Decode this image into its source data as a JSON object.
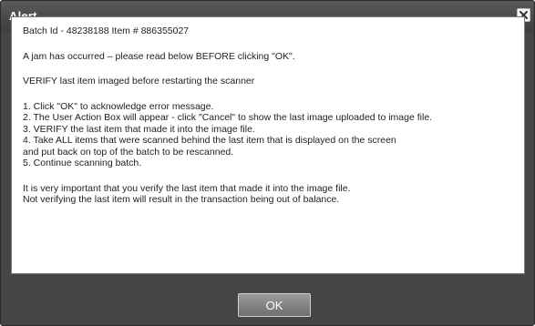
{
  "dialog": {
    "title": "Alert",
    "close_icon": "close-icon",
    "lines": {
      "batch": "Batch Id - 48238188 Item # 886355027",
      "jam": "A jam has occurred – please read below BEFORE clicking \"OK\".",
      "verify": "VERIFY last item imaged before restarting the scanner",
      "step1": "1. Click \"OK\" to acknowledge error message.",
      "step2": "2. The User Action Box will appear - click \"Cancel\" to show the last image uploaded to image file.",
      "step3": "3. VERIFY the last item that made it into the image file.",
      "step4a": "4. Take ALL items that were scanned behind the last item that is displayed on the screen",
      "step4b": "and put back on top of the batch to be rescanned.",
      "step5": "5. Continue scanning batch.",
      "important1": "It is very important that you verify the last item that made it into the image file.",
      "important2": "Not verifying the last item will result in the transaction being out of balance."
    },
    "ok_label": "OK"
  }
}
